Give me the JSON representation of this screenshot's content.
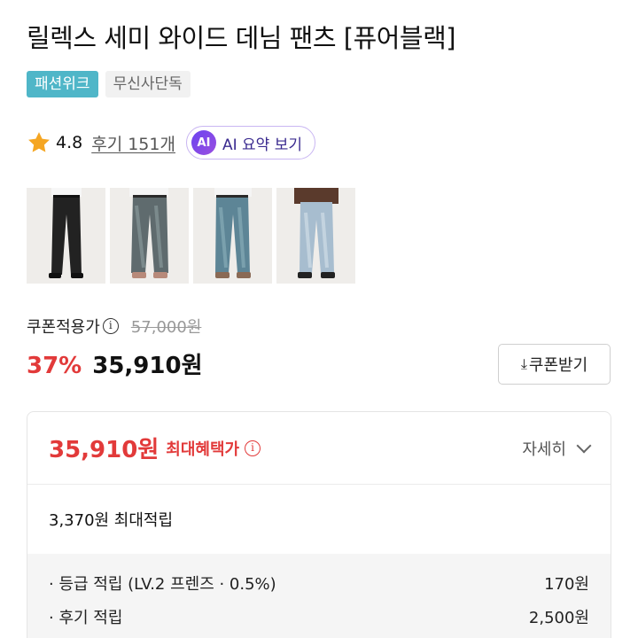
{
  "product": {
    "title": "릴렉스 세미 와이드 데님 팬츠 [퓨어블랙]",
    "tags": [
      "패션위크",
      "무신사단독"
    ]
  },
  "rating": {
    "score": "4.8",
    "review_link": "후기 151개",
    "ai_badge": "AI",
    "ai_label": "AI 요약 보기"
  },
  "thumbnails": [
    {
      "name": "black",
      "active": true
    },
    {
      "name": "grey-wash",
      "active": false
    },
    {
      "name": "blue-wash",
      "active": false
    },
    {
      "name": "light-wash",
      "active": false
    }
  ],
  "pricing": {
    "coupon_label": "쿠폰적용가",
    "info_glyph": "i",
    "original_price": "57,000원",
    "discount": "37%",
    "price": "35,910원",
    "coupon_button": "쿠폰받기",
    "coupon_icon": "⤓"
  },
  "benefit_box": {
    "max_price": "35,910원",
    "max_label": "최대혜택가",
    "detail_label": "자세히",
    "points_summary": "3,370원 최대적립",
    "points_detail": [
      {
        "label": "· 등급 적립 (LV.2 프렌즈 · 0.5%)",
        "value": "170원"
      },
      {
        "label": "· 후기 적립",
        "value": "2,500원"
      }
    ]
  },
  "colors": {
    "brand_tag": "#4fb6c8",
    "sale_red": "#e23a3a",
    "ai_purple": "#6b43f0"
  }
}
